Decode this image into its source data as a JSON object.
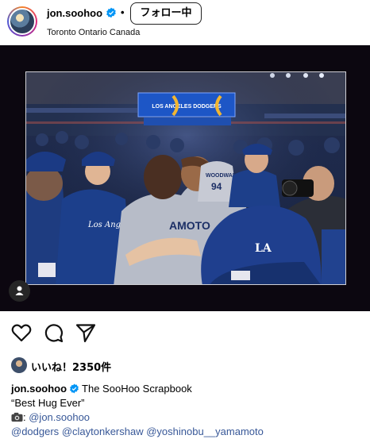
{
  "post": {
    "author": "jon.soohoo",
    "separator": "•",
    "follow_label": "フォロー中",
    "location": "Toronto Ontario Canada"
  },
  "photo": {
    "banner_text": "LOS ANGELES DODGERS",
    "jersey_text_1": "WOODWARD",
    "jersey_number": "94",
    "jersey_text_2": "AMOTO",
    "shirt_text": "Los Angeles",
    "cap_logo": "LA"
  },
  "likes": {
    "text": "いいね！2350件"
  },
  "caption": {
    "author": "jon.soohoo",
    "title": "The SooHoo Scrapbook",
    "quote": "“Best Hug Ever”",
    "camera_icon": "camera-icon",
    "camera_sep": ": ",
    "credit": "@jon.soohoo",
    "mentions": [
      "@dodgers",
      "@claytonkershaw",
      "@yoshinobu__yamamoto"
    ]
  },
  "colors": {
    "link": "#385898",
    "verified": "#0095f6",
    "dodger_blue": "#1d3f8a"
  }
}
